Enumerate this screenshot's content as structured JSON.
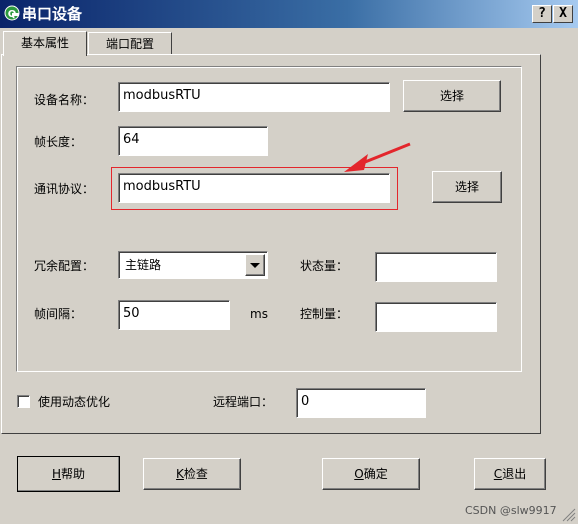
{
  "window": {
    "title": "串口设备",
    "help_button": "?",
    "close_button": "X"
  },
  "tabs": [
    {
      "label": "基本属性"
    },
    {
      "label": "端口配置"
    }
  ],
  "form": {
    "device_name": {
      "label": "设备名称：",
      "value": "modbusRTU",
      "button": "选择"
    },
    "frame_length": {
      "label": "帧长度：",
      "value": "64"
    },
    "protocol": {
      "label": "通讯协议：",
      "value": "modbusRTU",
      "button": "选择"
    },
    "redundancy": {
      "label": "冗余配置：",
      "value": "主链路"
    },
    "status_var": {
      "label": "状态量：",
      "value": ""
    },
    "frame_interval": {
      "label": "帧间隔：",
      "value": "50",
      "unit": "ms"
    },
    "control_var": {
      "label": "控制量：",
      "value": ""
    }
  },
  "options": {
    "dynamic_opt": {
      "label": "使用动态优化",
      "checked": false
    },
    "remote_port": {
      "label": "远程端口：",
      "value": "0"
    }
  },
  "buttons": {
    "help": {
      "key": "H",
      "text": "帮助"
    },
    "check": {
      "key": "K",
      "text": "检查"
    },
    "ok": {
      "key": "O",
      "text": "确定"
    },
    "cancel": {
      "key": "C",
      "text": "退出"
    }
  },
  "watermark": "CSDN @slw9917",
  "colors": {
    "annotation": "#e3262c",
    "title_start": "#0a246a",
    "title_end": "#a6caf0",
    "face": "#d4d0c8"
  }
}
